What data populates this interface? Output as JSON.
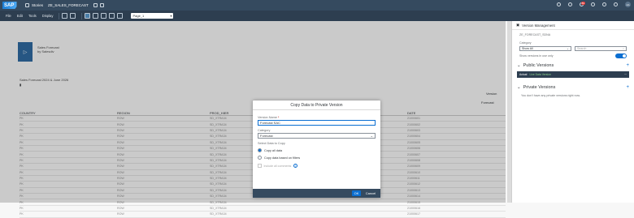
{
  "shell": {
    "logo": "SAP",
    "app": "Stories",
    "story": "ZE_SALES_FORECAST",
    "notifications_count": "89",
    "user_initials": "AA"
  },
  "toolbar": {
    "file": "File",
    "edit": "Edit",
    "tools": "Tools",
    "display": "Display",
    "page": "Page_1"
  },
  "canvas": {
    "tile_icon": "▷",
    "tile_title_line1": "Sales Forecast",
    "tile_title_line2": "by Salesdiv",
    "section_title": "Sales Forecast 2024 & June 2026",
    "mark": "▮",
    "version_label": "Version",
    "version_value": "Forecast"
  },
  "table": {
    "headers": [
      "COUNTRY",
      "REGION",
      "PROD_HIER",
      "DATE"
    ],
    "rows": [
      [
        "PK",
        "ROW",
        "SD_XTRA34",
        "21000601"
      ],
      [
        "PK",
        "ROW",
        "SD_XTRA34",
        "21000602"
      ],
      [
        "PK",
        "ROW",
        "SD_XTRA34",
        "21000603"
      ],
      [
        "PK",
        "ROW",
        "SD_XTRA34",
        "21000604"
      ],
      [
        "PK",
        "ROW",
        "SD_XTRA34",
        "21000605"
      ],
      [
        "PK",
        "ROW",
        "SD_XTRA34",
        "21000606"
      ],
      [
        "PK",
        "ROW",
        "SD_XTRA34",
        "21000607"
      ],
      [
        "PK",
        "ROW",
        "SD_XTRA34",
        "21000608"
      ],
      [
        "PK",
        "ROW",
        "SD_XTRA34",
        "21000609"
      ],
      [
        "PK",
        "ROW",
        "SD_XTRA34",
        "21000610"
      ],
      [
        "PK",
        "ROW",
        "SD_XTRA34",
        "21000611"
      ],
      [
        "PK",
        "ROW",
        "SD_XTRA34",
        "21000612"
      ],
      [
        "PK",
        "ROW",
        "SD_XTRA34",
        "21000613"
      ],
      [
        "PK",
        "ROW",
        "SD_XTRA34",
        "21000614"
      ],
      [
        "PK",
        "ROW",
        "SD_XTRA34",
        "21000615"
      ],
      [
        "PK",
        "ROW",
        "SD_XTRA34",
        "21000616"
      ],
      [
        "PK",
        "ROW",
        "SD_XTRA34",
        "21000617"
      ]
    ]
  },
  "dialog": {
    "title": "Copy Data to Private Version",
    "version_name_label": "Version Name",
    "required_mark": "*",
    "version_name_value": "Forecast SAC",
    "category_label": "Category",
    "category_value": "Forecast",
    "select_data_label": "Select Data to Copy",
    "option_all": "Copy all data",
    "option_filtered": "Copy data based on filters",
    "checkbox_label": "Include all comments",
    "ok": "OK",
    "cancel": "Cancel"
  },
  "panel": {
    "title": "Version Management",
    "model": "ZE_FORECAST_SDNA",
    "category_label": "Category",
    "category_value": "Show All",
    "search_placeholder": "Search",
    "toggle_label": "Show versions in use only",
    "public_title": "Public Versions",
    "public_item_name": "Actual",
    "public_item_tag": "Live Data Version",
    "private_title": "Private Versions",
    "private_empty": "You don't have any private versions right now."
  },
  "colors": {
    "shell_bg": "#354a5f",
    "accent": "#0a6ed1",
    "tile": "#2f6aa0"
  }
}
